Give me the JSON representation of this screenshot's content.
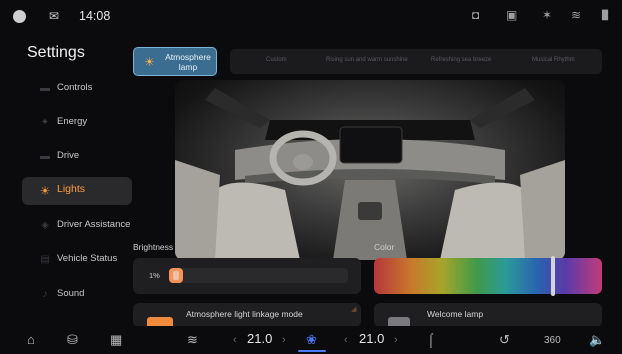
{
  "status_bar": {
    "time": "14:08",
    "icons_left": [
      "avatar-icon",
      "message-icon"
    ],
    "icons_right": [
      "camera-off-icon",
      "screen-off-icon",
      "bluetooth-icon",
      "wifi-icon",
      "signal-icon"
    ]
  },
  "sidebar": {
    "title": "Settings",
    "items": [
      {
        "label": "Controls",
        "icon": "controls-icon"
      },
      {
        "label": "Energy",
        "icon": "energy-icon"
      },
      {
        "label": "Drive",
        "icon": "drive-icon"
      },
      {
        "label": "Lights",
        "icon": "sun-icon",
        "active": true
      },
      {
        "label": "Driver Assistance",
        "icon": "assist-icon"
      },
      {
        "label": "Vehicle Status",
        "icon": "vehicle-icon"
      },
      {
        "label": "Sound",
        "icon": "sound-icon"
      }
    ]
  },
  "lighting": {
    "mode_selected": "Atmosphere lamp",
    "mode_options": [
      "Custom",
      "Rising sun and warm sunshine",
      "Refreshing sea breeze",
      "Musical Rhythm"
    ],
    "brightness_label": "Brightness",
    "brightness_value": "1%",
    "brightness_fraction": 0.01,
    "color_label": "Color",
    "color_position_fraction": 0.78,
    "colors": {
      "accent": "#ff9a3c",
      "mode_active": "#3a6d90"
    }
  },
  "cards": {
    "linkage": {
      "title": "Atmosphere light linkage mode",
      "on": true
    },
    "welcome": {
      "title": "Welcome lamp",
      "on": false
    }
  },
  "dock": {
    "left_temp": "21.0",
    "right_temp": "21.0",
    "icons": [
      "home-icon",
      "car-icon",
      "apps-icon",
      "defrost-icon",
      "fan-icon",
      "seat-heat-icon",
      "recirculation-icon",
      "view360-icon",
      "volume-icon"
    ],
    "view360_label": "360"
  }
}
